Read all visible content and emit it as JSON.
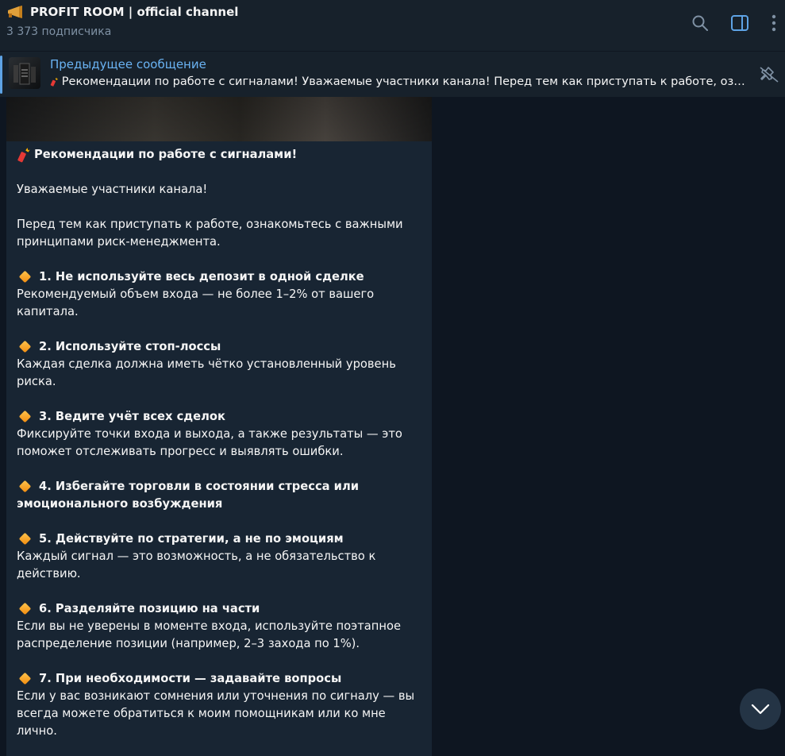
{
  "header": {
    "title": "PROFIT ROOM | official channel",
    "subscribers": "3 373 подписчика",
    "icons": [
      "megaphone-icon",
      "search-icon",
      "sidebar-toggle-icon",
      "more-vert-icon"
    ]
  },
  "pinned": {
    "title": "Предыдущее сообщение",
    "text": "Рекомендации по работе с сигналами!   Уважаемые участники канала!   Перед тем как приступать к работе, ознакомьтесь с важными принципами риск-менеджмента.",
    "icons": [
      "firecracker-icon",
      "unpin-icon"
    ]
  },
  "message": {
    "title": "Рекомендации по работе с сигналами!",
    "greeting": "Уважаемые участники канала!",
    "intro": "Перед тем как приступать к работе, ознакомьтесь с важными принципами риск-менеджмента.",
    "items": [
      {
        "heading": "1. Не используйте весь депозит в одной сделке",
        "body": "Рекомендуемый объем входа — не более 1–2% от вашего капитала."
      },
      {
        "heading": "2. Используйте стоп-лоссы",
        "body": "Каждая сделка должна иметь чётко установленный уровень риска."
      },
      {
        "heading": "3. Ведите учёт всех сделок",
        "body": "Фиксируйте точки входа и выхода, а также результаты — это поможет отслеживать прогресс и выявлять ошибки."
      },
      {
        "heading": "4. Избегайте торговли в состоянии стресса или эмоционального возбуждения",
        "body": ""
      },
      {
        "heading": "5. Действуйте по стратегии, а не по эмоциям",
        "body": "Каждый сигнал — это возможность, а не обязательство к действию."
      },
      {
        "heading": "6. Разделяйте позицию на части",
        "body": "Если вы не уверены в моменте входа, используйте поэтапное распределение позиции (например, 2–3 захода по 1%)."
      },
      {
        "heading": "7. При необходимости — задавайте вопросы",
        "body": "Если у вас возникают сомнения или уточнения по сигналу — вы всегда можете обратиться к моим помощникам или ко мне лично."
      }
    ]
  },
  "colors": {
    "background": "#0e1621",
    "header": "#17212b",
    "bubble": "#182533",
    "accent": "#6ab3f3",
    "muted": "#7f91a4",
    "text": "#f5f5f5"
  }
}
